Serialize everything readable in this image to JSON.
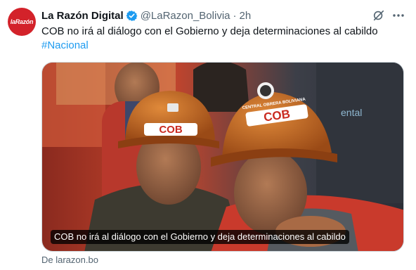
{
  "tweet": {
    "author_name": "La Razón Digital",
    "handle": "@LaRazon_Bolivia",
    "separator": "·",
    "time": "2h",
    "avatar_text": "laRazón",
    "text": "COB no irá al diálogo con el Gobierno y deja determinaciones al cabildo",
    "hashtag": "#Nacional",
    "card_caption": "COB no irá al diálogo con el Gobierno y deja determinaciones al cabildo",
    "source": "De larazon.bo",
    "helmet_text": "COB",
    "helmet_small_text": "CENTRAL OBRERA BOLIVIANA",
    "bg_text": "ental"
  },
  "icons": {
    "verified": "verified-badge-icon",
    "grok": "grok-icon",
    "more": "more-options-icon"
  },
  "colors": {
    "accent": "#1d9bf0",
    "avatar_bg": "#d3222a",
    "muted": "#536471"
  }
}
